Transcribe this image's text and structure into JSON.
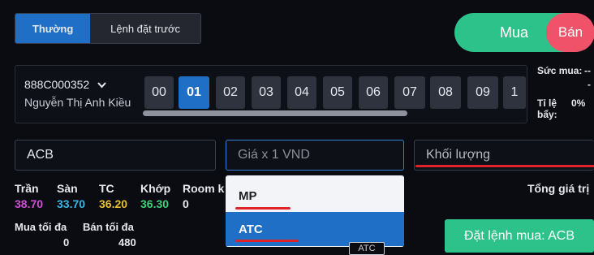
{
  "tabs": {
    "normal": "Thường",
    "pre_order": "Lệnh đặt trước"
  },
  "toggle": {
    "buy": "Mua",
    "sell": "Bán"
  },
  "account": {
    "id": "888C000352",
    "name": "Nguyễn Thị Anh Kiều",
    "subaccounts": [
      "00",
      "01",
      "02",
      "03",
      "04",
      "05",
      "06",
      "07",
      "08",
      "09",
      "1"
    ],
    "selected": "01"
  },
  "side_info": {
    "buying_power_label": "Sức mua:",
    "buying_power_value": "--",
    "buying_power_value2": "-",
    "leverage_label": "Tỉ lệ bẩy:",
    "leverage_value": "0%"
  },
  "form": {
    "symbol": "ACB",
    "price_placeholder": "Giá x 1 VND",
    "volume_placeholder": "Khối lượng"
  },
  "prices": {
    "ceiling_label": "Trần",
    "ceiling": "38.70",
    "floor_label": "Sàn",
    "floor": "33.70",
    "ref_label": "TC",
    "ref": "36.20",
    "match_label": "Khớp",
    "match": "36.30",
    "room_label": "Room k",
    "room": "0"
  },
  "limits": {
    "max_buy_label": "Mua tối đa",
    "max_buy": "0",
    "max_sell_label": "Bán tối đa",
    "max_sell": "480"
  },
  "total_label": "Tổng giá trị",
  "dropdown": {
    "options": [
      "MP",
      "ATC"
    ],
    "selected": "ATC"
  },
  "tooltip": "ATC",
  "submit": "Đặt lệnh mua: ACB",
  "colors": {
    "accent": "#1f6fc6",
    "buy": "#2ec28b",
    "sell": "#f0526a",
    "ceiling": "#d14fd8",
    "floor": "#36b8e8",
    "ref": "#e6c02e",
    "match": "#3fd07a",
    "annotation": "#e0232b"
  }
}
